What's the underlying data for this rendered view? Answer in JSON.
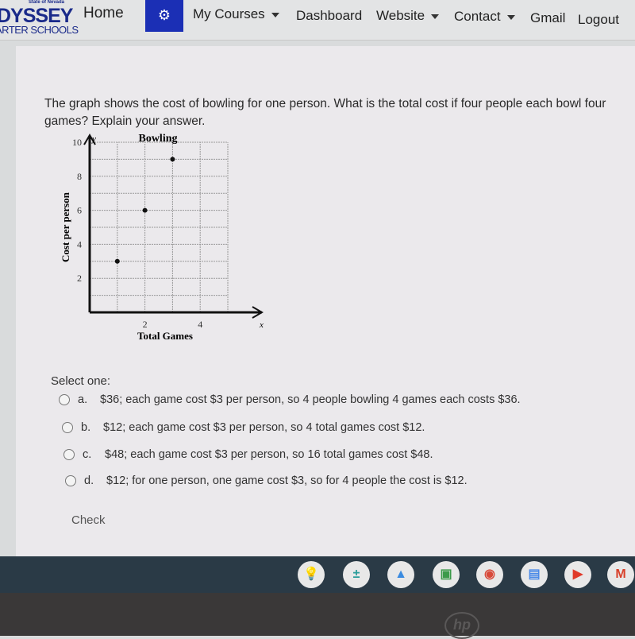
{
  "header": {
    "logo": {
      "state": "State of Nevada",
      "name": "DYSSEY",
      "sub": "ARTER SCHOOLS"
    },
    "nav": [
      {
        "label": "Home"
      },
      {
        "label": "My Courses",
        "dropdown": true
      },
      {
        "label": "Dashboard"
      },
      {
        "label": "Website",
        "dropdown": true
      },
      {
        "label": "Contact",
        "dropdown": true
      },
      {
        "label": "Gmail"
      },
      {
        "label": "Logout"
      }
    ],
    "settings_icon": "gears-icon",
    "accent": "#1b2fb5"
  },
  "question": {
    "text": "The graph shows the cost of bowling for one person. What is the total cost if four people each bowl four games? Explain your answer."
  },
  "chart_data": {
    "type": "scatter",
    "title": "Bowling",
    "xlabel": "Total Games",
    "ylabel": "Cost per person",
    "x_axis_letter": "x",
    "y_axis_letter": "y",
    "xlim": [
      0,
      5
    ],
    "ylim": [
      0,
      10
    ],
    "x_ticks": [
      2,
      4
    ],
    "y_ticks": [
      2,
      4,
      6,
      8,
      10
    ],
    "grid": true,
    "points": [
      {
        "x": 1,
        "y": 3
      },
      {
        "x": 2,
        "y": 6
      },
      {
        "x": 3,
        "y": 9
      }
    ]
  },
  "answers": {
    "prompt": "Select one:",
    "options": [
      {
        "letter": "a.",
        "text": "$36; each game cost $3 per person, so 4 people bowling 4 games each costs $36."
      },
      {
        "letter": "b.",
        "text": "$12; each game cost $3 per person, so 4 total games cost $12."
      },
      {
        "letter": "c.",
        "text": "$48; each game cost $3 per person, so 16 total games cost $48."
      },
      {
        "letter": "d.",
        "text": "$12; for one person, one game cost $3, so for 4 people the cost is $12."
      }
    ],
    "check_label": "Check"
  },
  "shelf": {
    "apps": [
      {
        "icon": "keep-icon",
        "color": "#e8c23a"
      },
      {
        "icon": "calculator-icon",
        "color": "#2a9d9a"
      },
      {
        "icon": "drive-icon",
        "color": "#3a8be0"
      },
      {
        "icon": "classroom-icon",
        "color": "#3c9a4a"
      },
      {
        "icon": "chrome-icon",
        "color": "#d84a3a"
      },
      {
        "icon": "docs-icon",
        "color": "#4a8ae8"
      },
      {
        "icon": "youtube-icon",
        "color": "#e03a2a"
      },
      {
        "icon": "gmail-icon",
        "color": "#d8402a"
      }
    ]
  },
  "bezel": {
    "brand": "hp"
  }
}
